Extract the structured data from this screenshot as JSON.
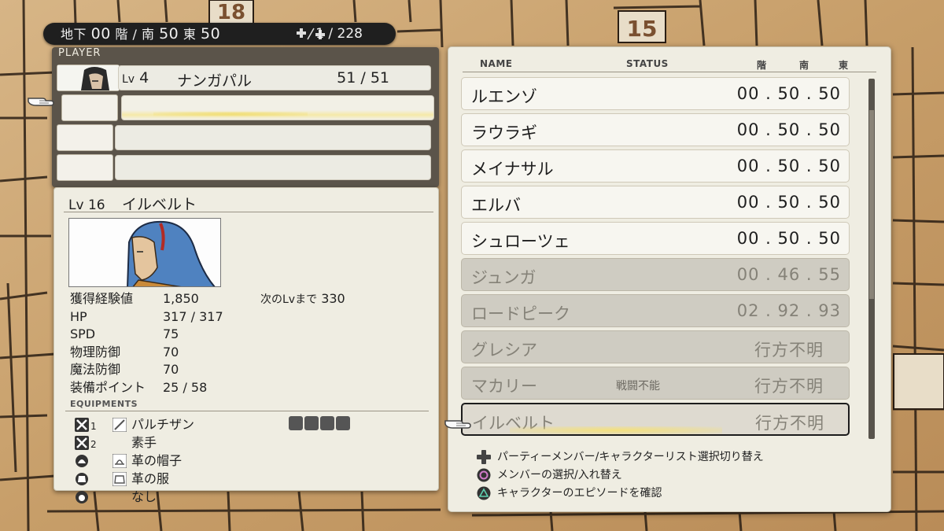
{
  "location_bar": {
    "floor_label": "地下",
    "floor_value": "00",
    "floor_unit": "階",
    "south_label": "南",
    "south_value": "50",
    "east_label": "東",
    "east_value": "50",
    "counter": "1 / 228"
  },
  "party": {
    "header": "PLAYER",
    "leader": {
      "lv_label": "Lv",
      "lv": "4",
      "name": "ナンガパル",
      "hp": "51 / 51"
    }
  },
  "character": {
    "lv_label": "Lv",
    "lv": "16",
    "name": "イルベルト",
    "stats": [
      {
        "label": "獲得経験値",
        "value": "1,850"
      },
      {
        "label": "HP",
        "value": "317 / 317"
      },
      {
        "label": "SPD",
        "value": "75"
      },
      {
        "label": "物理防御",
        "value": "70"
      },
      {
        "label": "魔法防御",
        "value": "70"
      },
      {
        "label": "装備ポイント",
        "value": "25 / 58"
      }
    ],
    "next_lv_label": "次のLvまで",
    "next_lv_value": "330",
    "equipments_header": "EQUIPMENTS",
    "equipments": [
      {
        "slot": "weapon",
        "slot_num": "1",
        "name": "パルチザン",
        "icon": "spear-icon"
      },
      {
        "slot": "weapon",
        "slot_num": "2",
        "name": "素手",
        "icon": ""
      },
      {
        "slot": "head",
        "slot_num": "",
        "name": "革の帽子",
        "icon": "hat-icon"
      },
      {
        "slot": "body",
        "slot_num": "",
        "name": "革の服",
        "icon": "armor-icon"
      },
      {
        "slot": "accessory",
        "slot_num": "",
        "name": "なし",
        "icon": ""
      }
    ]
  },
  "roster": {
    "col_name": "NAME",
    "col_status": "STATUS",
    "col_floor": "階",
    "col_south": "南",
    "col_east": "東",
    "items": [
      {
        "name": "ルエンゾ",
        "status": "",
        "location": "00 . 50 . 50",
        "dim": false,
        "selected": false
      },
      {
        "name": "ラウラギ",
        "status": "",
        "location": "00 . 50 . 50",
        "dim": false,
        "selected": false
      },
      {
        "name": "メイナサル",
        "status": "",
        "location": "00 . 50 . 50",
        "dim": false,
        "selected": false
      },
      {
        "name": "エルバ",
        "status": "",
        "location": "00 . 50 . 50",
        "dim": false,
        "selected": false
      },
      {
        "name": "シュローツェ",
        "status": "",
        "location": "00 . 50 . 50",
        "dim": false,
        "selected": false
      },
      {
        "name": "ジュンガ",
        "status": "",
        "location": "00 . 46 . 55",
        "dim": true,
        "selected": false
      },
      {
        "name": "ロードピーク",
        "status": "",
        "location": "02 . 92 . 93",
        "dim": true,
        "selected": false
      },
      {
        "name": "グレシア",
        "status": "",
        "location": "行方不明",
        "dim": true,
        "selected": false
      },
      {
        "name": "マカリー",
        "status": "戦闘不能",
        "location": "行方不明",
        "dim": true,
        "selected": false
      },
      {
        "name": "イルベルト",
        "status": "",
        "location": "行方不明",
        "dim": true,
        "selected": true
      }
    ],
    "help": [
      {
        "icon": "dpad-icon",
        "text": "パーティーメンバー/キャラクターリスト選択切り替え"
      },
      {
        "icon": "circle-button-icon",
        "text": "メンバーの選択/入れ替え"
      },
      {
        "icon": "triangle-button-icon",
        "text": "キャラクターのエピソードを確認"
      }
    ]
  },
  "map_labels": {
    "tile_a": "18",
    "tile_b": "15"
  }
}
